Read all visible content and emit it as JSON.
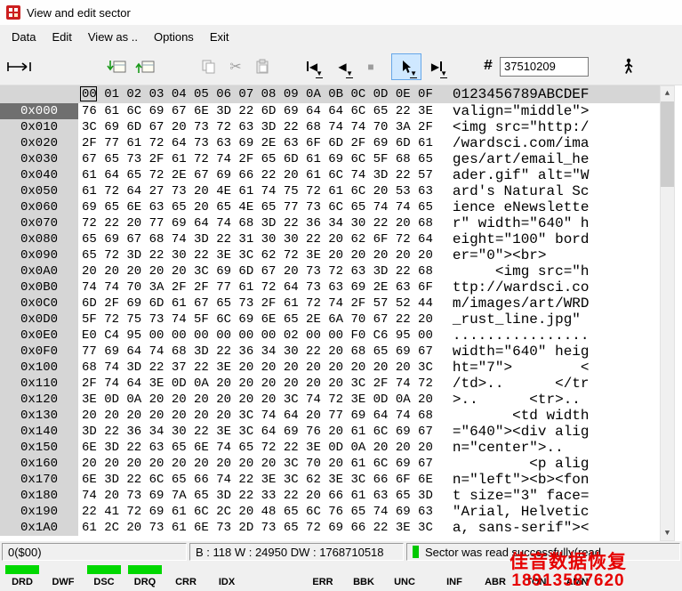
{
  "window": {
    "title": "View and edit sector"
  },
  "menu": {
    "items": [
      "Data",
      "Edit",
      "View as ..",
      "Options",
      "Exit"
    ]
  },
  "toolbar": {
    "sector_number": "37510209",
    "hash_label": "#",
    "icons": [
      "offset-ruler-icon",
      "read-sector-icon",
      "write-sector-icon",
      "copy-icon",
      "cut-icon",
      "paste-icon",
      "first-sector-icon",
      "previous-sector-icon",
      "stop-icon",
      "cursor-arrow-icon",
      "last-sector-icon",
      "hash-icon",
      "walking-person-icon"
    ]
  },
  "hex": {
    "col_header": "00 01 02 03 04 05 06 07 08 09 0A 0B 0C 0D 0E 0F",
    "ascii_header": "0123456789ABCDEF",
    "rows": [
      {
        "addr": "0x000",
        "selected": true,
        "bytes": [
          "76",
          "61",
          "6C",
          "69",
          "67",
          "6E",
          "3D",
          "22",
          "6D",
          "69",
          "64",
          "64",
          "6C",
          "65",
          "22",
          "3E"
        ],
        "ascii": "valign=\"middle\">"
      },
      {
        "addr": "0x010",
        "selected": false,
        "bytes": [
          "3C",
          "69",
          "6D",
          "67",
          "20",
          "73",
          "72",
          "63",
          "3D",
          "22",
          "68",
          "74",
          "74",
          "70",
          "3A",
          "2F"
        ],
        "ascii": "<img src=\"http:/"
      },
      {
        "addr": "0x020",
        "selected": false,
        "bytes": [
          "2F",
          "77",
          "61",
          "72",
          "64",
          "73",
          "63",
          "69",
          "2E",
          "63",
          "6F",
          "6D",
          "2F",
          "69",
          "6D",
          "61"
        ],
        "ascii": "/wardsci.com/ima"
      },
      {
        "addr": "0x030",
        "selected": false,
        "bytes": [
          "67",
          "65",
          "73",
          "2F",
          "61",
          "72",
          "74",
          "2F",
          "65",
          "6D",
          "61",
          "69",
          "6C",
          "5F",
          "68",
          "65"
        ],
        "ascii": "ges/art/email_he"
      },
      {
        "addr": "0x040",
        "selected": false,
        "bytes": [
          "61",
          "64",
          "65",
          "72",
          "2E",
          "67",
          "69",
          "66",
          "22",
          "20",
          "61",
          "6C",
          "74",
          "3D",
          "22",
          "57"
        ],
        "ascii": "ader.gif\" alt=\"W"
      },
      {
        "addr": "0x050",
        "selected": false,
        "bytes": [
          "61",
          "72",
          "64",
          "27",
          "73",
          "20",
          "4E",
          "61",
          "74",
          "75",
          "72",
          "61",
          "6C",
          "20",
          "53",
          "63"
        ],
        "ascii": "ard's Natural Sc"
      },
      {
        "addr": "0x060",
        "selected": false,
        "bytes": [
          "69",
          "65",
          "6E",
          "63",
          "65",
          "20",
          "65",
          "4E",
          "65",
          "77",
          "73",
          "6C",
          "65",
          "74",
          "74",
          "65"
        ],
        "ascii": "ience eNewslette"
      },
      {
        "addr": "0x070",
        "selected": false,
        "bytes": [
          "72",
          "22",
          "20",
          "77",
          "69",
          "64",
          "74",
          "68",
          "3D",
          "22",
          "36",
          "34",
          "30",
          "22",
          "20",
          "68"
        ],
        "ascii": "r\" width=\"640\" h"
      },
      {
        "addr": "0x080",
        "selected": false,
        "bytes": [
          "65",
          "69",
          "67",
          "68",
          "74",
          "3D",
          "22",
          "31",
          "30",
          "30",
          "22",
          "20",
          "62",
          "6F",
          "72",
          "64"
        ],
        "ascii": "eight=\"100\" bord"
      },
      {
        "addr": "0x090",
        "selected": false,
        "bytes": [
          "65",
          "72",
          "3D",
          "22",
          "30",
          "22",
          "3E",
          "3C",
          "62",
          "72",
          "3E",
          "20",
          "20",
          "20",
          "20",
          "20"
        ],
        "ascii": "er=\"0\"><br>     "
      },
      {
        "addr": "0x0A0",
        "selected": false,
        "bytes": [
          "20",
          "20",
          "20",
          "20",
          "20",
          "3C",
          "69",
          "6D",
          "67",
          "20",
          "73",
          "72",
          "63",
          "3D",
          "22",
          "68"
        ],
        "ascii": "     <img src=\"h"
      },
      {
        "addr": "0x0B0",
        "selected": false,
        "bytes": [
          "74",
          "74",
          "70",
          "3A",
          "2F",
          "2F",
          "77",
          "61",
          "72",
          "64",
          "73",
          "63",
          "69",
          "2E",
          "63",
          "6F"
        ],
        "ascii": "ttp://wardsci.co"
      },
      {
        "addr": "0x0C0",
        "selected": false,
        "bytes": [
          "6D",
          "2F",
          "69",
          "6D",
          "61",
          "67",
          "65",
          "73",
          "2F",
          "61",
          "72",
          "74",
          "2F",
          "57",
          "52",
          "44"
        ],
        "ascii": "m/images/art/WRD"
      },
      {
        "addr": "0x0D0",
        "selected": false,
        "bytes": [
          "5F",
          "72",
          "75",
          "73",
          "74",
          "5F",
          "6C",
          "69",
          "6E",
          "65",
          "2E",
          "6A",
          "70",
          "67",
          "22",
          "20"
        ],
        "ascii": "_rust_line.jpg\" "
      },
      {
        "addr": "0x0E0",
        "selected": false,
        "bytes": [
          "E0",
          "C4",
          "95",
          "00",
          "00",
          "00",
          "00",
          "00",
          "00",
          "02",
          "00",
          "00",
          "F0",
          "C6",
          "95",
          "00"
        ],
        "ascii": "................"
      },
      {
        "addr": "0x0F0",
        "selected": false,
        "bytes": [
          "77",
          "69",
          "64",
          "74",
          "68",
          "3D",
          "22",
          "36",
          "34",
          "30",
          "22",
          "20",
          "68",
          "65",
          "69",
          "67"
        ],
        "ascii": "width=\"640\" heig"
      },
      {
        "addr": "0x100",
        "selected": false,
        "bytes": [
          "68",
          "74",
          "3D",
          "22",
          "37",
          "22",
          "3E",
          "20",
          "20",
          "20",
          "20",
          "20",
          "20",
          "20",
          "20",
          "3C"
        ],
        "ascii": "ht=\"7\">        <"
      },
      {
        "addr": "0x110",
        "selected": false,
        "bytes": [
          "2F",
          "74",
          "64",
          "3E",
          "0D",
          "0A",
          "20",
          "20",
          "20",
          "20",
          "20",
          "20",
          "3C",
          "2F",
          "74",
          "72"
        ],
        "ascii": "/td>..      </tr"
      },
      {
        "addr": "0x120",
        "selected": false,
        "bytes": [
          "3E",
          "0D",
          "0A",
          "20",
          "20",
          "20",
          "20",
          "20",
          "20",
          "3C",
          "74",
          "72",
          "3E",
          "0D",
          "0A",
          "20"
        ],
        "ascii": ">..      <tr>.. "
      },
      {
        "addr": "0x130",
        "selected": false,
        "bytes": [
          "20",
          "20",
          "20",
          "20",
          "20",
          "20",
          "20",
          "3C",
          "74",
          "64",
          "20",
          "77",
          "69",
          "64",
          "74",
          "68"
        ],
        "ascii": "       <td width"
      },
      {
        "addr": "0x140",
        "selected": false,
        "bytes": [
          "3D",
          "22",
          "36",
          "34",
          "30",
          "22",
          "3E",
          "3C",
          "64",
          "69",
          "76",
          "20",
          "61",
          "6C",
          "69",
          "67"
        ],
        "ascii": "=\"640\"><div alig"
      },
      {
        "addr": "0x150",
        "selected": false,
        "bytes": [
          "6E",
          "3D",
          "22",
          "63",
          "65",
          "6E",
          "74",
          "65",
          "72",
          "22",
          "3E",
          "0D",
          "0A",
          "20",
          "20",
          "20"
        ],
        "ascii": "n=\"center\">..   "
      },
      {
        "addr": "0x160",
        "selected": false,
        "bytes": [
          "20",
          "20",
          "20",
          "20",
          "20",
          "20",
          "20",
          "20",
          "20",
          "3C",
          "70",
          "20",
          "61",
          "6C",
          "69",
          "67"
        ],
        "ascii": "         <p alig"
      },
      {
        "addr": "0x170",
        "selected": false,
        "bytes": [
          "6E",
          "3D",
          "22",
          "6C",
          "65",
          "66",
          "74",
          "22",
          "3E",
          "3C",
          "62",
          "3E",
          "3C",
          "66",
          "6F",
          "6E"
        ],
        "ascii": "n=\"left\"><b><fon"
      },
      {
        "addr": "0x180",
        "selected": false,
        "bytes": [
          "74",
          "20",
          "73",
          "69",
          "7A",
          "65",
          "3D",
          "22",
          "33",
          "22",
          "20",
          "66",
          "61",
          "63",
          "65",
          "3D"
        ],
        "ascii": "t size=\"3\" face="
      },
      {
        "addr": "0x190",
        "selected": false,
        "bytes": [
          "22",
          "41",
          "72",
          "69",
          "61",
          "6C",
          "2C",
          "20",
          "48",
          "65",
          "6C",
          "76",
          "65",
          "74",
          "69",
          "63"
        ],
        "ascii": "\"Arial, Helvetic"
      },
      {
        "addr": "0x1A0",
        "selected": false,
        "bytes": [
          "61",
          "2C",
          "20",
          "73",
          "61",
          "6E",
          "73",
          "2D",
          "73",
          "65",
          "72",
          "69",
          "66",
          "22",
          "3E",
          "3C"
        ],
        "ascii": "a, sans-serif\"><"
      }
    ]
  },
  "status": {
    "left": "0($00)",
    "values": "B : 118 W : 24950 DW : 1768710518",
    "message": "Sector was read successfully(read"
  },
  "leds": {
    "items": [
      {
        "label": "DRD",
        "on": true
      },
      {
        "label": "DWF",
        "on": false
      },
      {
        "label": "DSC",
        "on": true
      },
      {
        "label": "DRQ",
        "on": true
      },
      {
        "label": "CRR",
        "on": false
      },
      {
        "label": "IDX",
        "on": false
      },
      {
        "label": "ERR",
        "on": false
      },
      {
        "label": "BBK",
        "on": false
      },
      {
        "label": "UNC",
        "on": false
      },
      {
        "label": "INF",
        "on": false
      },
      {
        "label": "ABR",
        "on": false
      },
      {
        "label": "TON",
        "on": false
      },
      {
        "label": "AMN",
        "on": false
      }
    ]
  },
  "watermark": {
    "line1": "佳音数据恢复",
    "line2": "18913587620"
  },
  "colors": {
    "led_green": "#00d800",
    "status_green": "#00c800",
    "watermark_red": "#e60000",
    "selected_address_bg": "#6f6f6f",
    "active_button_border": "#66a7e8"
  }
}
